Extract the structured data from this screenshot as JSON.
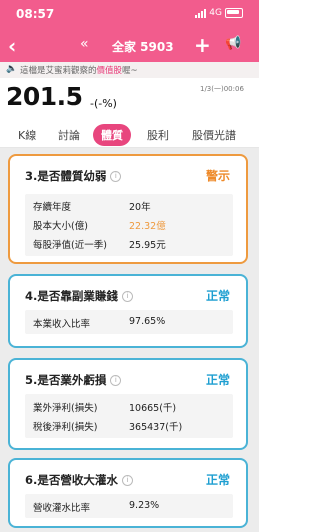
{
  "statusbar": {
    "time": "08:57",
    "network": "4G"
  },
  "navbar": {
    "back_icon": "chevron-left-icon",
    "double_icon": "double-chevron-left-icon",
    "double_glyph": "«",
    "title": "全家 5903",
    "plus_glyph": "+",
    "megaphone_glyph": "📢"
  },
  "notice": {
    "prefix": "這檔是艾蜜莉觀察的",
    "highlight": "價值股",
    "suffix": "喔~"
  },
  "quote": {
    "price": "201.5",
    "change": "-(-%)",
    "datetime": "1/3(一)00:06"
  },
  "tabs": [
    "K線",
    "討論",
    "體質",
    "股利",
    "股價光譜"
  ],
  "active_tab_index": 2,
  "cards": [
    {
      "title": "3.是否體質幼弱",
      "status": "警示",
      "status_color": "#ee8a2a",
      "rows": [
        {
          "label": "存續年度",
          "value": "20年",
          "highlight": false
        },
        {
          "label": "股本大小(億)",
          "value": "22.32億",
          "highlight": true
        },
        {
          "label": "每股淨值(近一季)",
          "value": "25.95元",
          "highlight": false
        }
      ]
    },
    {
      "title": "4.是否靠副業賺錢",
      "status": "正常",
      "status_color": "#1f9fd1",
      "rows": [
        {
          "label": "本業收入比率",
          "value": "97.65%",
          "highlight": false
        }
      ]
    },
    {
      "title": "5.是否業外虧損",
      "status": "正常",
      "status_color": "#1f9fd1",
      "rows": [
        {
          "label": "業外淨利(損失)",
          "value": "10665(千)",
          "highlight": false
        },
        {
          "label": "稅後淨利(損失)",
          "value": "365437(千)",
          "highlight": false
        }
      ]
    },
    {
      "title": "6.是否營收大灌水",
      "status": "正常",
      "status_color": "#1f9fd1",
      "rows": [
        {
          "label": "營收灌水比率",
          "value": "9.23%",
          "highlight": false
        }
      ]
    }
  ],
  "colors": {
    "brand": "#f25c8d",
    "warn": "#ee9a3f",
    "normal": "#4ab3d6"
  }
}
